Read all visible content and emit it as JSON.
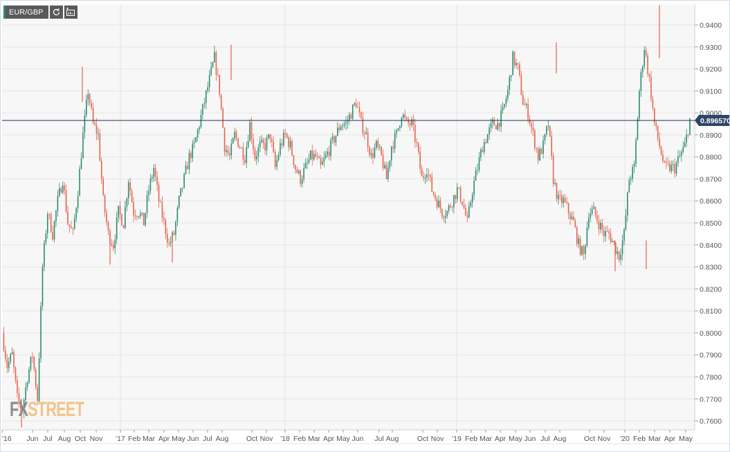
{
  "toolbar": {
    "symbol": "EUR/GBP",
    "refresh_icon": "refresh-icon",
    "indicators_icon": "indicators-icon"
  },
  "logo": {
    "part1": "FX",
    "part2": "STREET"
  },
  "colors": {
    "up": "#2a8a6e",
    "down": "#e8604c",
    "background": "#f7f7f7",
    "grid": "#e6e6e6",
    "price_line": "#1f3550",
    "price_tag": "#2c4766"
  },
  "chart_data": {
    "type": "candlestick",
    "title": "EUR/GBP",
    "interval": "approx. weekly closes, Apr 2016 - May 2020",
    "ylim": [
      0.755,
      0.95
    ],
    "y_ticks": [
      "0.7600",
      "0.7700",
      "0.7800",
      "0.7900",
      "0.8000",
      "0.8100",
      "0.8200",
      "0.8300",
      "0.8400",
      "0.8500",
      "0.8600",
      "0.8700",
      "0.8800",
      "0.8900",
      "0.9000",
      "0.9100",
      "0.9200",
      "0.9300",
      "0.9400"
    ],
    "x_ticks": [
      "'16",
      "Jun",
      "Jul",
      "Aug",
      "Oct",
      "Nov",
      "'17",
      "Feb",
      "Mar",
      "Apr",
      "May",
      "Jun",
      "Jul",
      "Aug",
      "Oct",
      "Nov",
      "'18",
      "Feb",
      "Mar",
      "Apr",
      "May",
      "Jun",
      "Jul",
      "Aug",
      "Oct",
      "Nov",
      "'19",
      "Feb",
      "Mar",
      "Apr",
      "May",
      "Jun",
      "Jul",
      "Aug",
      "Oct",
      "Nov",
      "'20",
      "Feb",
      "Mar",
      "Apr",
      "May"
    ],
    "current_price": "0.896570",
    "current_price_value": 0.89657,
    "closes": [
      0.8,
      0.785,
      0.79,
      0.77,
      0.765,
      0.78,
      0.79,
      0.77,
      0.83,
      0.855,
      0.845,
      0.86,
      0.87,
      0.85,
      0.845,
      0.865,
      0.89,
      0.91,
      0.895,
      0.89,
      0.86,
      0.845,
      0.84,
      0.855,
      0.85,
      0.87,
      0.855,
      0.855,
      0.85,
      0.865,
      0.875,
      0.86,
      0.85,
      0.84,
      0.845,
      0.86,
      0.87,
      0.88,
      0.885,
      0.895,
      0.905,
      0.915,
      0.925,
      0.91,
      0.885,
      0.88,
      0.89,
      0.885,
      0.88,
      0.895,
      0.88,
      0.885,
      0.885,
      0.89,
      0.875,
      0.885,
      0.89,
      0.885,
      0.875,
      0.87,
      0.875,
      0.88,
      0.88,
      0.875,
      0.88,
      0.885,
      0.89,
      0.895,
      0.895,
      0.9,
      0.905,
      0.895,
      0.89,
      0.88,
      0.885,
      0.88,
      0.87,
      0.885,
      0.89,
      0.9,
      0.895,
      0.895,
      0.885,
      0.87,
      0.875,
      0.865,
      0.86,
      0.855,
      0.855,
      0.86,
      0.865,
      0.86,
      0.85,
      0.865,
      0.875,
      0.885,
      0.89,
      0.895,
      0.895,
      0.9,
      0.91,
      0.925,
      0.92,
      0.905,
      0.9,
      0.89,
      0.88,
      0.885,
      0.895,
      0.87,
      0.86,
      0.86,
      0.855,
      0.85,
      0.84,
      0.835,
      0.855,
      0.855,
      0.85,
      0.845,
      0.845,
      0.84,
      0.835,
      0.845,
      0.87,
      0.875,
      0.91,
      0.93,
      0.915,
      0.895,
      0.885,
      0.875,
      0.875,
      0.875,
      0.88,
      0.885,
      0.897
    ],
    "notable_highs": [
      0.921,
      0.931,
      0.91,
      0.932,
      0.949
    ],
    "notable_lows": [
      0.757,
      0.831,
      0.829,
      0.828
    ]
  }
}
